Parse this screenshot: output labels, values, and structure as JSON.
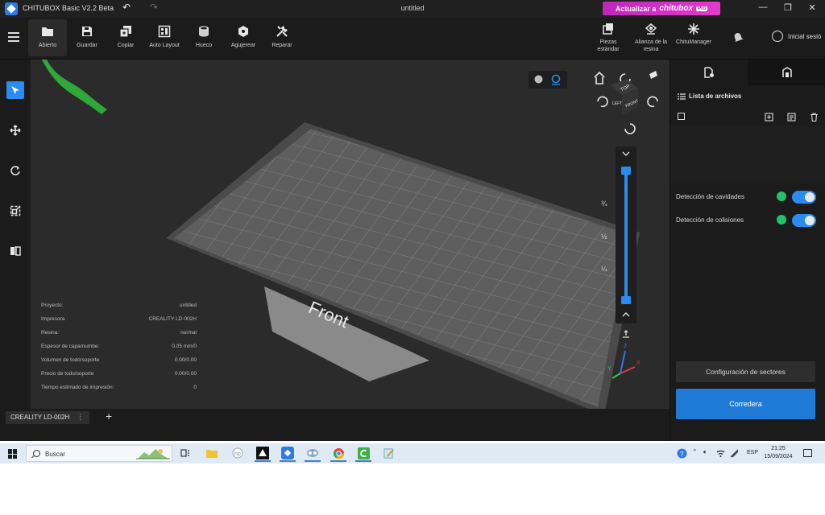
{
  "window": {
    "app_title": "CHITUBOX Basic V2.2 Beta",
    "document_title": "untitled",
    "upgrade_prefix": "Actualizar a",
    "upgrade_brand": "chitubox",
    "upgrade_badge": "Pro",
    "controls": [
      "minimize-icon",
      "restore-icon",
      "close-icon"
    ]
  },
  "toolbar": {
    "tools": [
      {
        "label": "Abierto",
        "icon": "folder-icon",
        "active": true
      },
      {
        "label": "Guardar",
        "icon": "save-icon"
      },
      {
        "label": "Copiar",
        "icon": "copy-icon"
      },
      {
        "label": "Auto Layout",
        "icon": "auto-layout-icon"
      },
      {
        "label": "Hueco",
        "icon": "hollow-icon"
      },
      {
        "label": "Agujerear",
        "icon": "drill-icon"
      },
      {
        "label": "Reparar",
        "icon": "repair-icon"
      }
    ],
    "right_tools": [
      {
        "line1": "Piezas",
        "line2": "estándar",
        "icon": "parts-icon"
      },
      {
        "line1": "Alianza de la",
        "line2": "resina",
        "icon": "resin-alliance-icon"
      },
      {
        "line1": "ChituManager",
        "line2": "",
        "icon": "chitumanager-icon"
      }
    ],
    "login_label": "Inicial sesió"
  },
  "left_rail": [
    "select-icon",
    "move-icon",
    "rotate-icon",
    "scale-icon",
    "mirror-icon"
  ],
  "viewport": {
    "plate_label": "Front",
    "cube_labels": {
      "top": "TOP",
      "left": "LEFT",
      "right": "FRONT"
    },
    "layer_marks": [
      "¾",
      "½",
      "¼"
    ],
    "axes": {
      "x": "X",
      "y": "Y",
      "z": "Z"
    },
    "info": [
      {
        "label": "Proyecto:",
        "value": "untitled"
      },
      {
        "label": "Impresora",
        "value": "CREALITY LD-002H"
      },
      {
        "label": "Resina:",
        "value": "normal"
      },
      {
        "label": "Espesor de capa/numbe:",
        "value": "0.05 mm/0"
      },
      {
        "label": "Volumen de todo/soporte",
        "value": "0.00/0.00"
      },
      {
        "label": "Precio de todo/soporte",
        "value": "0.00/0.00"
      },
      {
        "label": "Tiempo estimado de impresión:",
        "value": "0"
      }
    ]
  },
  "bottom": {
    "printer_tab": "CREALITY LD-002H",
    "tab_menu": "⋮",
    "add_tab": "+"
  },
  "right_panel": {
    "files_title": "Lista de archivos",
    "toggles": [
      {
        "label": "Detección de cavidades",
        "on": true
      },
      {
        "label": "Detección de colisiones",
        "on": true
      }
    ],
    "sector_button": "Configuración de sectores",
    "slice_button": "Corredera"
  },
  "taskbar": {
    "search_placeholder": "Buscar",
    "apps": [
      "task-view-icon",
      "file-explorer-icon",
      "hp-icon",
      "inkscape-icon",
      "chitubox-icon",
      "app-icon",
      "chrome-icon",
      "camtasia-icon",
      "notepad-icon"
    ],
    "language": "ESP",
    "time": "21:25",
    "date": "15/09/2024"
  },
  "colors": {
    "accent": "#2a8cf0",
    "upgrade": "#d22fc4",
    "toggle_ok": "#21c36a"
  }
}
